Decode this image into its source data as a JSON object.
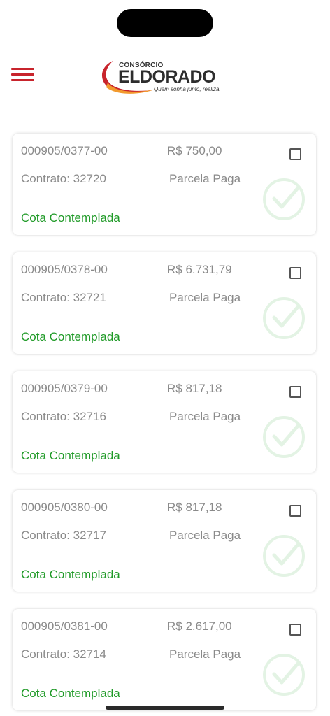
{
  "header": {
    "logo_small": "CONSÓRCIO",
    "logo_main": "ELDORADO",
    "logo_slogan": "Quem sonha junto, realiza."
  },
  "colors": {
    "brand_red": "#c8242c",
    "brand_orange": "#f29a2e",
    "contemplada_green": "#1f9a27",
    "muted_text": "#8a8a8a",
    "check_icon_green": "#e3f3e4"
  },
  "cards": [
    {
      "number": "000905/0377-00",
      "amount": "R$ 750,00",
      "contract": "Contrato: 32720",
      "status": "Parcela Paga",
      "cota": "Cota Contemplada"
    },
    {
      "number": "000905/0378-00",
      "amount": "R$ 6.731,79",
      "contract": "Contrato: 32721",
      "status": "Parcela Paga",
      "cota": "Cota Contemplada"
    },
    {
      "number": "000905/0379-00",
      "amount": "R$ 817,18",
      "contract": "Contrato: 32716",
      "status": "Parcela Paga",
      "cota": "Cota Contemplada"
    },
    {
      "number": "000905/0380-00",
      "amount": "R$ 817,18",
      "contract": "Contrato: 32717",
      "status": "Parcela Paga",
      "cota": "Cota Contemplada"
    },
    {
      "number": "000905/0381-00",
      "amount": "R$ 2.617,00",
      "contract": "Contrato: 32714",
      "status": "Parcela Paga",
      "cota": "Cota Contemplada"
    }
  ],
  "icons": {
    "menu": "hamburger-menu-icon",
    "checkbox": "checkbox-icon",
    "paid": "check-circle-icon"
  }
}
